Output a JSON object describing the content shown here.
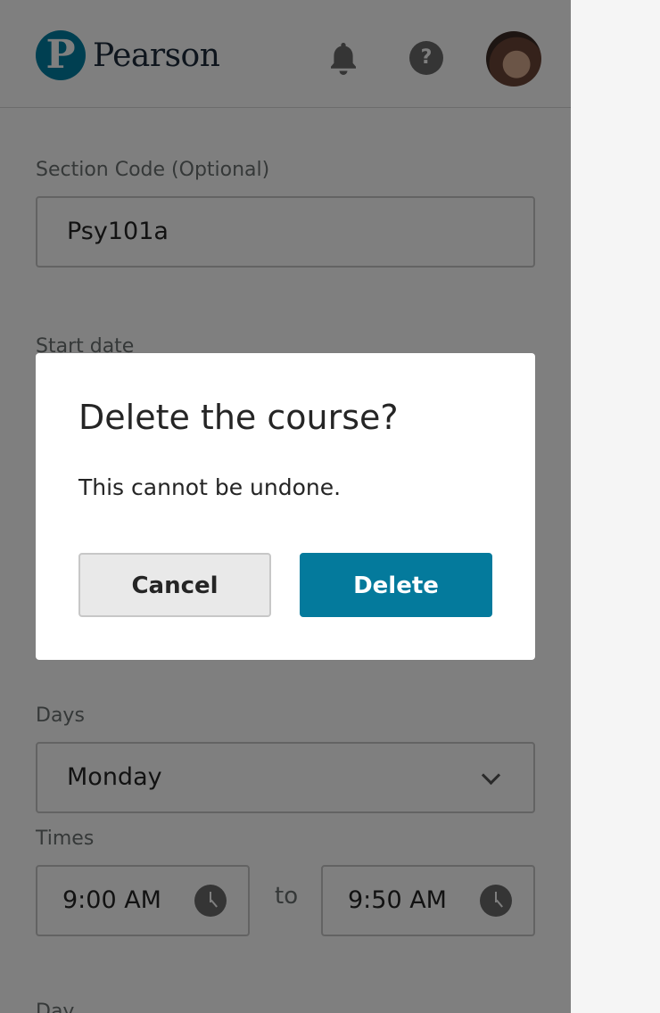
{
  "header": {
    "logo_letter": "P",
    "logo_text": "Pearson",
    "help_icon_text": "?"
  },
  "form": {
    "section_code_label": "Section Code (Optional)",
    "section_code_value": "Psy101a",
    "start_date_label": "Start date",
    "days_label": "Days",
    "days_value": "Monday",
    "times_label": "Times",
    "time_start": "9:00 AM",
    "time_separator": "to",
    "time_end": "9:50 AM",
    "partial_label": "Day"
  },
  "modal": {
    "title": "Delete the course?",
    "body": "This cannot be undone.",
    "cancel_label": "Cancel",
    "delete_label": "Delete"
  },
  "colors": {
    "brand": "#007fa3",
    "delete_button": "#047a9c",
    "overlay": "rgba(0,0,0,0.5)"
  }
}
